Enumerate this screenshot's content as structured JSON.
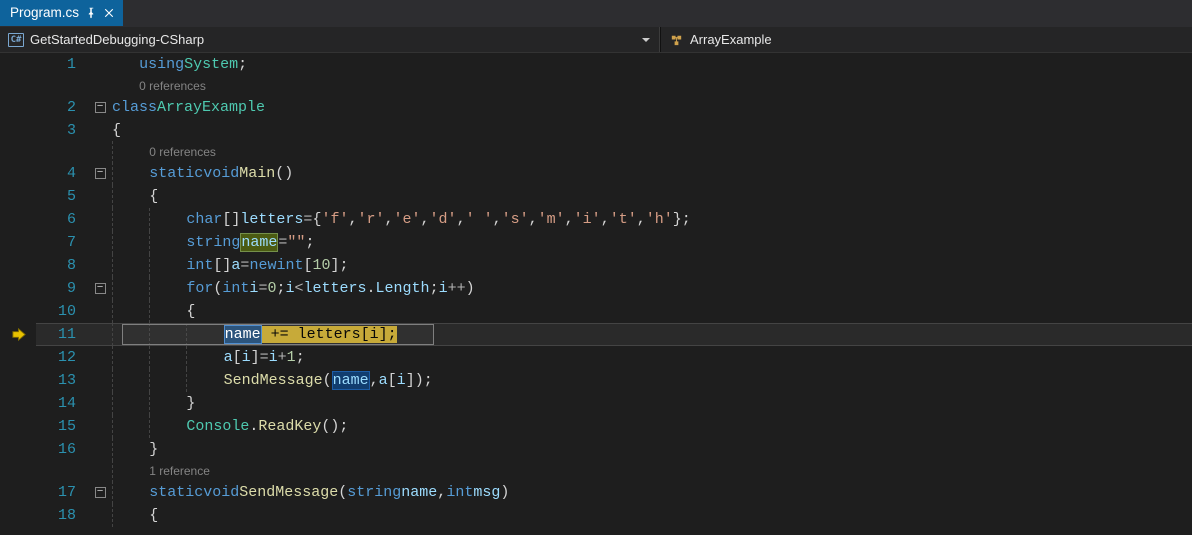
{
  "tab": {
    "title": "Program.cs"
  },
  "navbar": {
    "project": "GetStartedDebugging-CSharp",
    "member": "ArrayExample"
  },
  "tokens": {
    "using": "using",
    "System": "System",
    "class": "class",
    "ArrayExample": "ArrayExample",
    "static": "static",
    "void": "void",
    "Main": "Main",
    "char": "char",
    "letters": "letters",
    "f": "'f'",
    "r": "'r'",
    "e": "'e'",
    "d": "'d'",
    "sp": "' '",
    "s": "'s'",
    "m": "'m'",
    "i": "'i'",
    "t": "'t'",
    "h": "'h'",
    "string": "string",
    "name": "name",
    "empty": "\"\"",
    "int": "int",
    "a": "a",
    "new": "new",
    "ten": "10",
    "for": "for",
    "ivar": "i",
    "zero": "0",
    "Length": "Length",
    "plusplus": "++",
    "plus_eq": "+=",
    "one": "1",
    "SendMessage": "SendMessage",
    "Console": "Console",
    "ReadKey": "ReadKey",
    "msg": "msg"
  },
  "codelens": {
    "zero": "0 references",
    "one": "1 reference"
  },
  "lines": {
    "1": "1",
    "2": "2",
    "3": "3",
    "4": "4",
    "5": "5",
    "6": "6",
    "7": "7",
    "8": "8",
    "9": "9",
    "10": "10",
    "11": "11",
    "12": "12",
    "13": "13",
    "14": "14",
    "15": "15",
    "16": "16",
    "17": "17",
    "18": "18"
  }
}
